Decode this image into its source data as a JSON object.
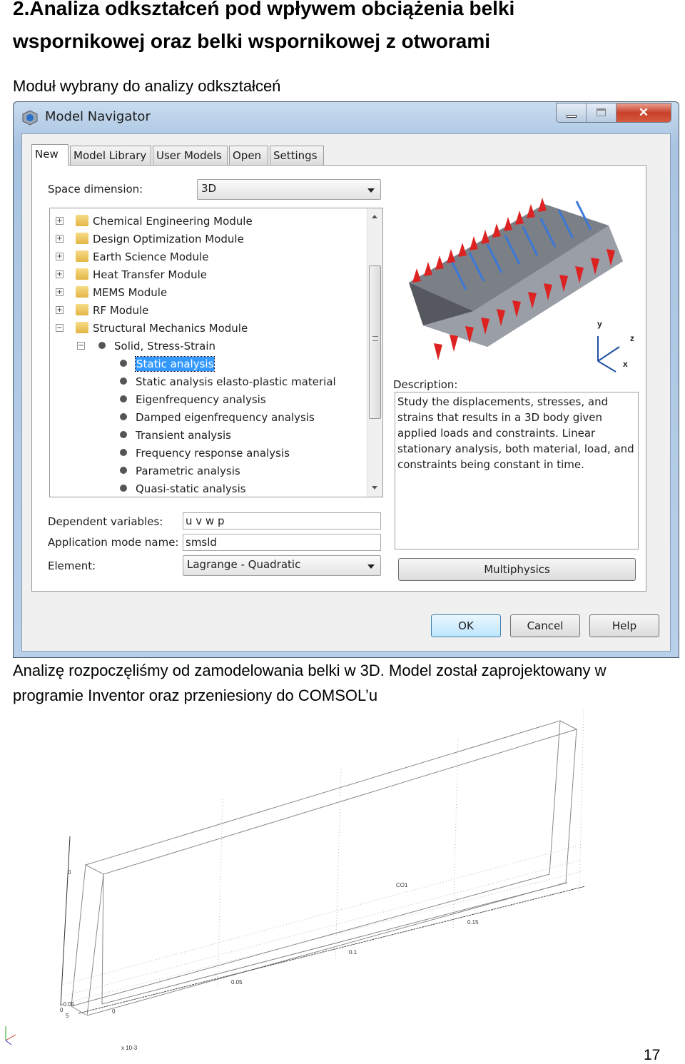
{
  "heading": [
    "2.Analiza odkształceń pod wpływem obciążenia belki",
    "wspornikowej oraz belki wspornikowej z otworami"
  ],
  "subtitle": "Moduł wybrany do analizy odkształceń",
  "dialog": {
    "title": "Model Navigator",
    "icon": "comsol-logo-icon",
    "tabs": [
      "New",
      "Model Library",
      "User Models",
      "Open",
      "Settings"
    ],
    "active_tab": "New",
    "space_dimension_label": "Space dimension:",
    "space_dimension_value": "3D",
    "tree": [
      {
        "label": "Chemical Engineering Module",
        "level": 0,
        "expanded": false
      },
      {
        "label": "Design Optimization Module",
        "level": 0,
        "expanded": false
      },
      {
        "label": "Earth Science Module",
        "level": 0,
        "expanded": false
      },
      {
        "label": "Heat Transfer Module",
        "level": 0,
        "expanded": false
      },
      {
        "label": "MEMS Module",
        "level": 0,
        "expanded": false
      },
      {
        "label": "RF Module",
        "level": 0,
        "expanded": false
      },
      {
        "label": "Structural Mechanics Module",
        "level": 0,
        "expanded": true
      },
      {
        "label": "Solid, Stress-Strain",
        "level": 1,
        "expanded": true
      },
      {
        "label": "Static analysis",
        "level": 2,
        "selected": true
      },
      {
        "label": "Static analysis elasto-plastic material",
        "level": 2
      },
      {
        "label": "Eigenfrequency analysis",
        "level": 2
      },
      {
        "label": "Damped eigenfrequency analysis",
        "level": 2
      },
      {
        "label": "Transient analysis",
        "level": 2
      },
      {
        "label": "Frequency response analysis",
        "level": 2
      },
      {
        "label": "Parametric analysis",
        "level": 2
      },
      {
        "label": "Quasi-static analysis",
        "level": 2
      }
    ],
    "description_label": "Description:",
    "description": "Study the displacements, stresses, and strains that results in a 3D body given applied loads and constraints. Linear stationary analysis, both material, load, and constraints being constant in time.",
    "dependent_variables_label": "Dependent variables:",
    "dependent_variables_value": "u v w p",
    "app_mode_label": "Application mode name:",
    "app_mode_value": "smsld",
    "element_label": "Element:",
    "element_value": "Lagrange - Quadratic",
    "multiphysics": "Multiphysics",
    "ok": "OK",
    "cancel": "Cancel",
    "help": "Help",
    "axis_labels": [
      "y",
      "z",
      "x"
    ],
    "selection_color": "#3399ff"
  },
  "body_text": [
    "Analizę rozpoczęliśmy od zamodelowania belki w 3D. Model został zaprojektowany w",
    "programie Inventor oraz przeniesiony do COMSOL’u"
  ],
  "model_view": {
    "label": "CO1",
    "ticks": [
      "0",
      "0.05",
      "0.1",
      "0.15"
    ],
    "side_ticks": [
      "0",
      "-0.05",
      "0",
      "5"
    ],
    "scale": "x 10-3"
  },
  "page_number": "17"
}
